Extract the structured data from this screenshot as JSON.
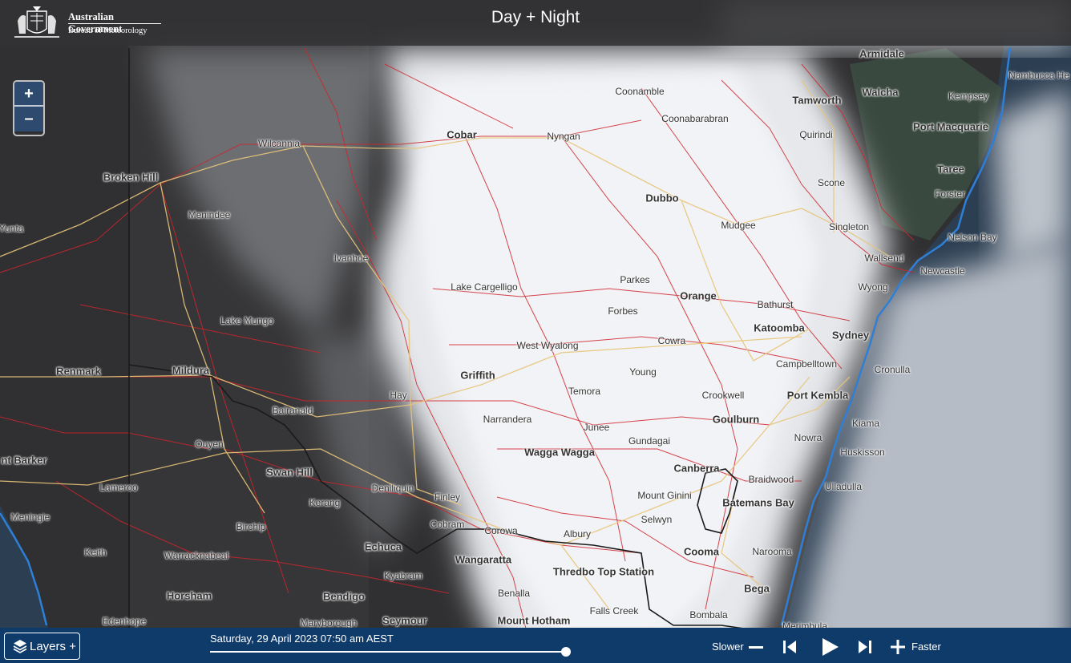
{
  "header": {
    "logo_line1": "Australian Government",
    "logo_line2": "Bureau of Meteorology",
    "title": "Day + Night"
  },
  "zoom": {
    "in_label": "+",
    "out_label": "–"
  },
  "footer": {
    "layers_label": "Layers +",
    "datetime": "Saturday, 29 April 2023 07:50 am AEST",
    "timeline_progress": 1.0,
    "slower_label": "Slower",
    "faster_label": "Faster"
  },
  "colors": {
    "header_bg": "#323234",
    "footer_bg": "#0f3b6b",
    "zoom_button": "#2e4a6e",
    "coastline": "#2f7fd6",
    "roads": "#d0242c",
    "highways": "#e8c57a",
    "state_border": "#1a1a1a"
  },
  "map": {
    "place_labels": [
      {
        "name": "Broken Hill"
      },
      {
        "name": "Menindee"
      },
      {
        "name": "Yunta"
      },
      {
        "name": "Wilcannia"
      },
      {
        "name": "Ivanhoe"
      },
      {
        "name": "Lake Mungo"
      },
      {
        "name": "Mildura"
      },
      {
        "name": "Renmark"
      },
      {
        "name": "Balranald"
      },
      {
        "name": "Ouyen"
      },
      {
        "name": "nt Barker"
      },
      {
        "name": "Lameroo"
      },
      {
        "name": "Meningie"
      },
      {
        "name": "Keith"
      },
      {
        "name": "Swan Hill"
      },
      {
        "name": "Kerang"
      },
      {
        "name": "Birchip"
      },
      {
        "name": "Warracknabeal"
      },
      {
        "name": "Horsham"
      },
      {
        "name": "Edenhope"
      },
      {
        "name": "Bendigo"
      },
      {
        "name": "Echuca"
      },
      {
        "name": "Kyabram"
      },
      {
        "name": "Maryborough"
      },
      {
        "name": "Seymour"
      },
      {
        "name": "Wangaratta"
      },
      {
        "name": "Benalla"
      },
      {
        "name": "Mount Hotham"
      },
      {
        "name": "Deniliquin"
      },
      {
        "name": "Finley"
      },
      {
        "name": "Cobram"
      },
      {
        "name": "Corowa"
      },
      {
        "name": "Albury"
      },
      {
        "name": "Hay"
      },
      {
        "name": "Griffith"
      },
      {
        "name": "Narrandera"
      },
      {
        "name": "Wagga Wagga"
      },
      {
        "name": "Junee"
      },
      {
        "name": "Temora"
      },
      {
        "name": "West Wyalong"
      },
      {
        "name": "Lake Cargelligo"
      },
      {
        "name": "Cobar"
      },
      {
        "name": "Nyngan"
      },
      {
        "name": "Coonamble"
      },
      {
        "name": "Coonabarabran"
      },
      {
        "name": "Dubbo"
      },
      {
        "name": "Mudgee"
      },
      {
        "name": "Parkes"
      },
      {
        "name": "Forbes"
      },
      {
        "name": "Orange"
      },
      {
        "name": "Bathurst"
      },
      {
        "name": "Cowra"
      },
      {
        "name": "Young"
      },
      {
        "name": "Crookwell"
      },
      {
        "name": "Gundagai"
      },
      {
        "name": "Goulburn"
      },
      {
        "name": "Canberra"
      },
      {
        "name": "Mount Ginini"
      },
      {
        "name": "Selwyn"
      },
      {
        "name": "Thredbo Top Station"
      },
      {
        "name": "Falls Creek"
      },
      {
        "name": "Cooma"
      },
      {
        "name": "Bombala"
      },
      {
        "name": "Bega"
      },
      {
        "name": "Narooma"
      },
      {
        "name": "Batemans Bay"
      },
      {
        "name": "Braidwood"
      },
      {
        "name": "Ulladulla"
      },
      {
        "name": "Huskisson"
      },
      {
        "name": "Nowra"
      },
      {
        "name": "Kiama"
      },
      {
        "name": "Port Kembla"
      },
      {
        "name": "Campbelltown"
      },
      {
        "name": "Cronulla"
      },
      {
        "name": "Sydney"
      },
      {
        "name": "Katoomba"
      },
      {
        "name": "Wyong"
      },
      {
        "name": "Wallsend"
      },
      {
        "name": "Newcastle"
      },
      {
        "name": "Nelson Bay"
      },
      {
        "name": "Singleton"
      },
      {
        "name": "Scone"
      },
      {
        "name": "Forster"
      },
      {
        "name": "Taree"
      },
      {
        "name": "Port Macquarie"
      },
      {
        "name": "Kempsey"
      },
      {
        "name": "Nambucca He"
      },
      {
        "name": "Armidale"
      },
      {
        "name": "Walcha"
      },
      {
        "name": "Tamworth"
      },
      {
        "name": "Quirindi"
      },
      {
        "name": "Merimbula"
      }
    ]
  }
}
